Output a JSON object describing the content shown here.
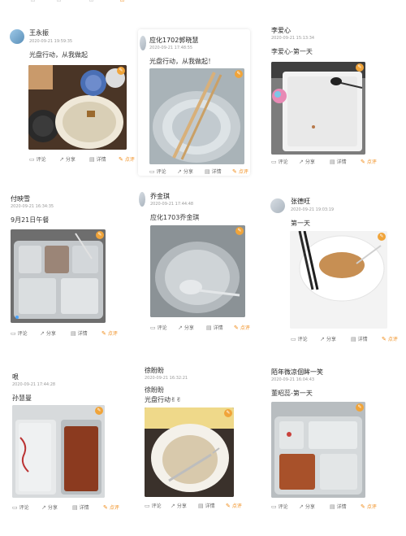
{
  "actions": {
    "comment": "评论",
    "share": "分享",
    "detail": "详情",
    "evaluate": "点评"
  },
  "cards": [
    {
      "name": "王永振",
      "time": "2020-09-21 19:59:35",
      "text": "光盘行动，从我做起"
    },
    {
      "name": "应化1702郭晓慧",
      "time": "2020-09-21 17:48:55",
      "text": "光盘行动，从我做起！"
    },
    {
      "name": "李爱心",
      "time": "2020-09-21 15:13:34",
      "text": "李爱心-第一天"
    },
    {
      "name": "付映雪",
      "time": "2020-09-21 16:34:35",
      "text": "9月21日午餐"
    },
    {
      "name": "乔金琪",
      "time": "2020-09-21 17:44:48",
      "text": "应化1703乔金琪"
    },
    {
      "name": "张德旺",
      "time": "2020-09-21 19:03:19",
      "text": "第一天"
    },
    {
      "name": "哏",
      "time": "2020-09-21 17:44:28",
      "text": "孙慧曼"
    },
    {
      "name": "徐盼盼",
      "time": "2020-09-21 16:32:21",
      "text": "徐盼盼",
      "text2": "光盘行动✌✌"
    },
    {
      "name": "陌年微凉佪眸一笑",
      "time": "2020-09-21 16:04:43",
      "text": "董昭蕊-第一天"
    }
  ],
  "colors": {
    "accent": "#f08c1a",
    "muted": "#9a9a9a"
  },
  "icons": {
    "comment": "comment-icon",
    "share": "share-icon",
    "detail": "detail-icon",
    "evaluate": "edit-icon",
    "photo_badge": "pencil-icon"
  }
}
